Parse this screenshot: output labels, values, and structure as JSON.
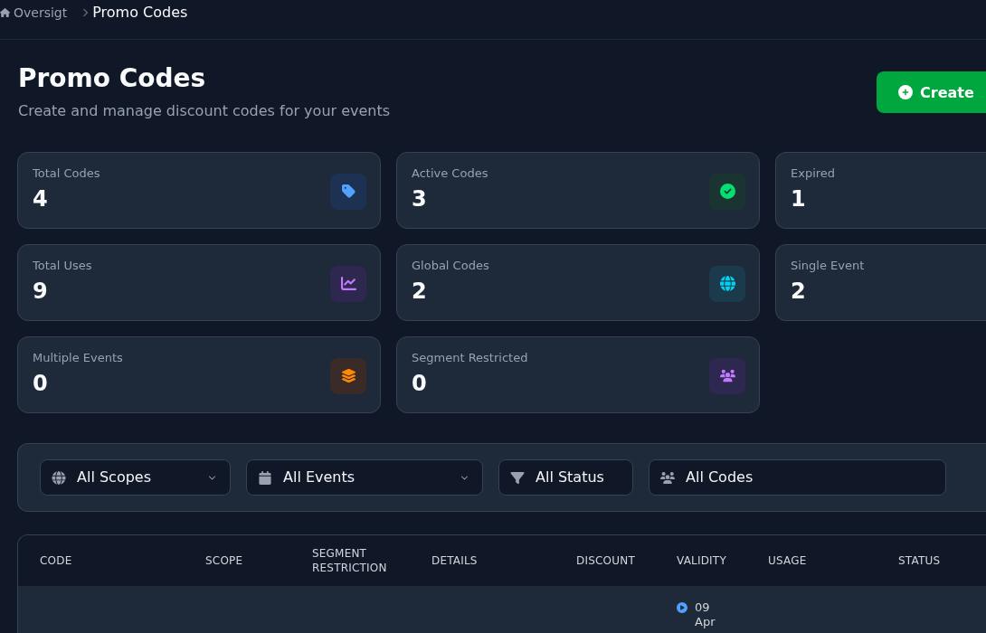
{
  "breadcrumb": [
    {
      "kind": "home",
      "label": "Oversigt",
      "current": false
    },
    {
      "kind": "page",
      "label": "Promo Codes",
      "current": true
    }
  ],
  "header": {
    "title": "Promo Codes",
    "subtitle": "Create and manage discount codes for your events",
    "create_button": "Create"
  },
  "stats": [
    {
      "label": "Total Codes",
      "value": "4"
    },
    {
      "label": "Active Codes",
      "value": "3"
    },
    {
      "label": "Expired",
      "value": "1"
    },
    {
      "label": "Total Uses",
      "value": "9"
    },
    {
      "label": "Global Codes",
      "value": "2"
    },
    {
      "label": "Single Event",
      "value": "2"
    },
    {
      "label": "Multiple Events",
      "value": "0"
    },
    {
      "label": "Segment Restricted",
      "value": "0"
    }
  ],
  "filters": [
    {
      "label": "All Scopes",
      "caret": true
    },
    {
      "label": "All Events",
      "caret": true
    },
    {
      "label": "All Status",
      "caret": false
    },
    {
      "label": "All Codes",
      "caret": false
    }
  ],
  "table": {
    "columns": [
      "CODE",
      "SCOPE",
      "SEGMENT RESTRICTION",
      "DETAILS",
      "DISCOUNT",
      "VALIDITY",
      "USAGE",
      "STATUS"
    ],
    "rows": [
      {
        "validity": "09 Apr"
      }
    ]
  }
}
